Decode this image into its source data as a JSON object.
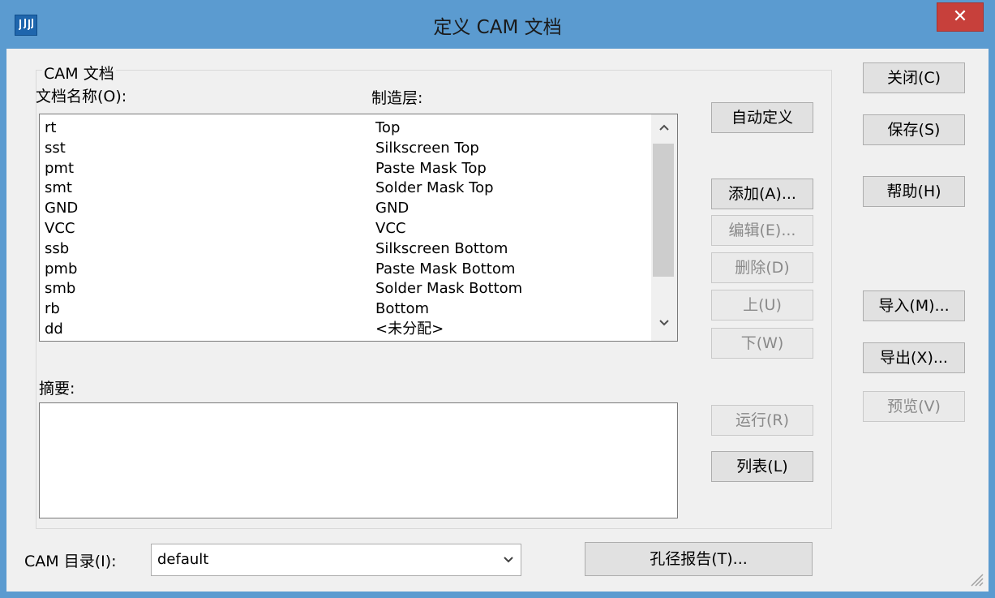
{
  "window": {
    "title": "定义 CAM 文档",
    "close_label": "✕"
  },
  "group": {
    "title": "CAM 文档"
  },
  "columns": {
    "name_label": "文档名称(O):",
    "layer_label": "制造层:"
  },
  "documents": [
    {
      "name": "rt",
      "layer": "Top"
    },
    {
      "name": "sst",
      "layer": "Silkscreen Top"
    },
    {
      "name": "pmt",
      "layer": "Paste Mask Top"
    },
    {
      "name": "smt",
      "layer": "Solder Mask Top"
    },
    {
      "name": "GND",
      "layer": "GND"
    },
    {
      "name": "VCC",
      "layer": "VCC"
    },
    {
      "name": "ssb",
      "layer": "Silkscreen Bottom"
    },
    {
      "name": "pmb",
      "layer": "Paste Mask Bottom"
    },
    {
      "name": "smb",
      "layer": "Solder Mask Bottom"
    },
    {
      "name": "rb",
      "layer": "Bottom"
    },
    {
      "name": "dd",
      "layer": "<未分配>"
    }
  ],
  "summary": {
    "label": "摘要:"
  },
  "middle_buttons": {
    "auto_define": "自动定义",
    "add": "添加(A)...",
    "edit": "编辑(E)...",
    "delete": "删除(D)",
    "up": "上(U)",
    "down": "下(W)",
    "run": "运行(R)",
    "list": "列表(L)"
  },
  "right_buttons": {
    "close": "关闭(C)",
    "save": "保存(S)",
    "help": "帮助(H)",
    "import": "导入(M)...",
    "export": "导出(X)...",
    "preview": "预览(V)"
  },
  "cam_dir": {
    "label": "CAM 目录(I):",
    "value": "default"
  },
  "drill_report": {
    "label": "孔径报告(T)..."
  },
  "icons": {
    "app": "cam-app-icon",
    "scroll_up": "chevron-up-icon",
    "scroll_down": "chevron-down-icon",
    "dropdown": "chevron-down-icon",
    "grip": "resize-grip-icon"
  },
  "colors": {
    "titlebar": "#5b9bd0",
    "close": "#c7403b",
    "face": "#f0f0f0"
  }
}
